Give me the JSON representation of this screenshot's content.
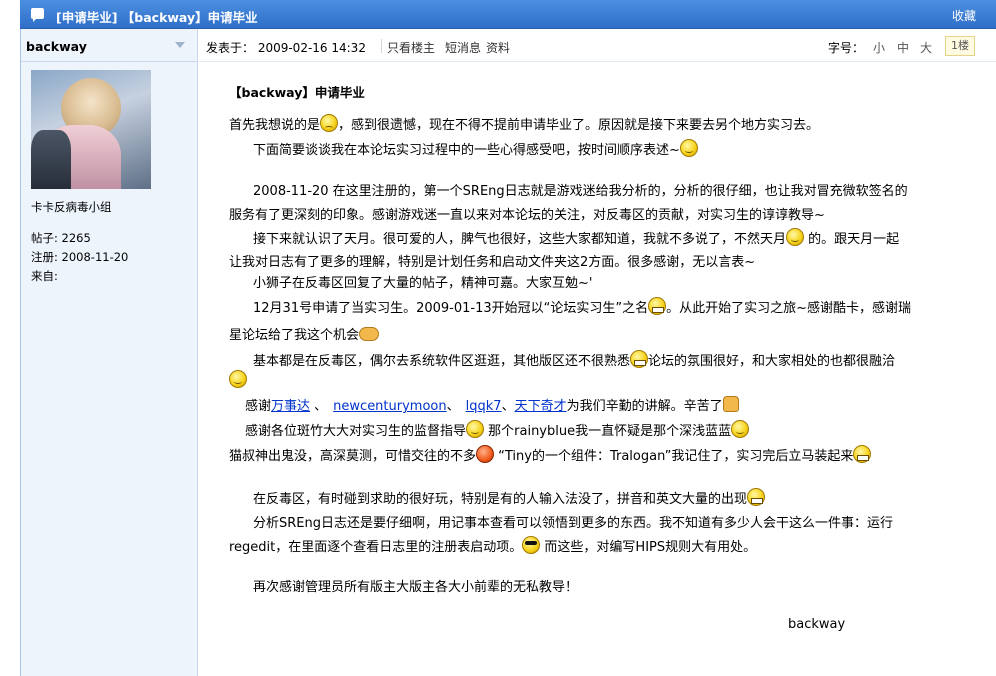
{
  "window": {
    "title": "[申请毕业] 【backway】申请毕业",
    "favorite_label": "收藏"
  },
  "author": {
    "name": "backway",
    "group": "卡卡反病毒小组",
    "posts": "帖子: 2265",
    "registered": "注册:  2008-11-20",
    "from": "来自:"
  },
  "topbar": {
    "posted": "发表于： 2009-02-16 14:32",
    "only_author": "只看楼主",
    "message": "短消息",
    "profile": "资料",
    "font_size_label": "字号：",
    "font_small": "小",
    "font_medium": "中",
    "font_large": "大",
    "floor": "1楼"
  },
  "post": {
    "title": "【backway】申请毕业",
    "p1a": "首先我想说的是",
    "p1b": "，感到很遗憾，现在不得不提前申请毕业了。原因就是接下来要去另个地方实习去。",
    "p2": "下面简要谈谈我在本论坛实习过程中的一些心得感受吧，按时间顺序表述~",
    "p3a": "2008-11-20 在这里注册的，第一个SREng日志就是游戏迷给我分析的，分析的很仔细，也让我对冒充微软签名的",
    "p3b": "服务有了更深刻的印象。感谢游戏迷一直以来对本论坛的关注，对反毒区的贡献，对实习生的谆谆教导~",
    "p4a1": "接下来就认识了天月。很可爱的人，脾气也很好，这些大家都知道，我就不多说了，不然天月",
    "p4a2": "的。跟天月一起",
    "p4b": "让我对日志有了更多的理解，特别是计划任务和启动文件夹这2方面。很多感谢，无以言表~",
    "p5": "小狮子在反毒区回复了大量的帖子，精神可嘉。大家互勉~'",
    "p6a1": "12月31号申请了当实习生。2009-01-13开始冠以“论坛实习生”之名",
    "p6a2": "。从此开始了实习之旅~感谢酷卡，感谢瑞",
    "p6b": "星论坛给了我这个机会",
    "p7a1": "基本都是在反毒区，偶尔去系统软件区逛逛，其他版区还不很熟悉",
    "p7a2": "论坛的氛围很好，和大家相处的也都很融洽",
    "p8_prefix": "感谢",
    "p8_link1": "万事达",
    "p8_sep1": " 、",
    "p8_link2": "newcenturymoon",
    "p8_sep2": "、",
    "p8_link3": "lqqk7",
    "p8_sep3": "、",
    "p8_link4": "天下奇才",
    "p8_suffix": "为我们辛勤的讲解。辛苦了",
    "p9a": "感谢各位斑竹大大对实习生的监督指导",
    "p9b": " 那个rainyblue我一直怀疑是那个深浅蓝蓝",
    "p10a": "猫叔神出鬼没，高深莫测，可惜交往的不多",
    "p10b": " “Tiny的一个组件：Tralogan”我记住了，实习完后立马装起来",
    "p11": "在反毒区，有时碰到求助的很好玩，特别是有的人输入法没了，拼音和英文大量的出现",
    "p12a": "分析SREng日志还是要仔细啊，用记事本查看可以领悟到更多的东西。我不知道有多少人会干这么一件事：运行",
    "p12b1": "regedit，在里面逐个查看日志里的注册表启动项。",
    "p12b2": " 而这些，对编写HIPS规则大有用处。",
    "p13": "再次感谢管理员所有版主大版主各大小前辈的无私教导！",
    "signature": "backway"
  }
}
